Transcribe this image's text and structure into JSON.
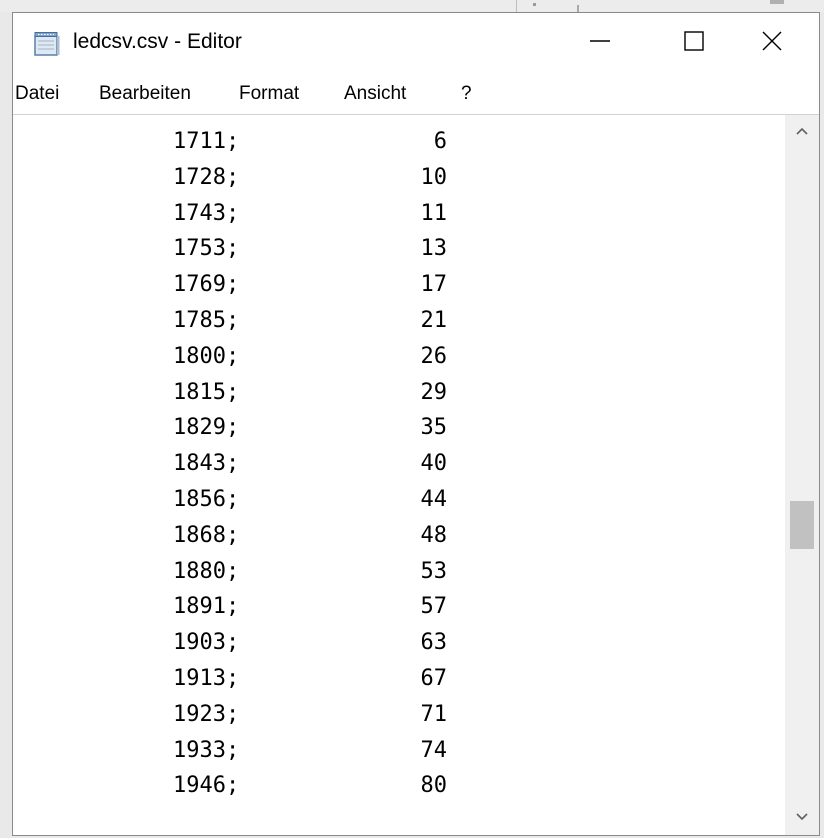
{
  "window": {
    "title": "ledcsv.csv - Editor",
    "icon": "notepad-icon",
    "controls": {
      "minimize_icon": "minimize-icon",
      "maximize_icon": "maximize-icon",
      "close_icon": "close-icon"
    }
  },
  "menu": {
    "items": [
      "Datei",
      "Bearbeiten",
      "Format",
      "Ansicht",
      "?"
    ]
  },
  "editor": {
    "rows": [
      {
        "year": "1711;",
        "value": "6"
      },
      {
        "year": "1728;",
        "value": "10"
      },
      {
        "year": "1743;",
        "value": "11"
      },
      {
        "year": "1753;",
        "value": "13"
      },
      {
        "year": "1769;",
        "value": "17"
      },
      {
        "year": "1785;",
        "value": "21"
      },
      {
        "year": "1800;",
        "value": "26"
      },
      {
        "year": "1815;",
        "value": "29"
      },
      {
        "year": "1829;",
        "value": "35"
      },
      {
        "year": "1843;",
        "value": "40"
      },
      {
        "year": "1856;",
        "value": "44"
      },
      {
        "year": "1868;",
        "value": "48"
      },
      {
        "year": "1880;",
        "value": "53"
      },
      {
        "year": "1891;",
        "value": "57"
      },
      {
        "year": "1903;",
        "value": "63"
      },
      {
        "year": "1913;",
        "value": "67"
      },
      {
        "year": "1923;",
        "value": "71"
      },
      {
        "year": "1933;",
        "value": "74"
      },
      {
        "year": "1946;",
        "value": "80"
      }
    ]
  },
  "scrollbar": {
    "up_icon": "scroll-up-arrow-icon",
    "down_icon": "scroll-down-arrow-icon"
  },
  "colors": {
    "window_border": "#8a8a8a",
    "scrollbar_track": "#f0f0f0",
    "scrollbar_thumb": "#c1c1c1"
  }
}
